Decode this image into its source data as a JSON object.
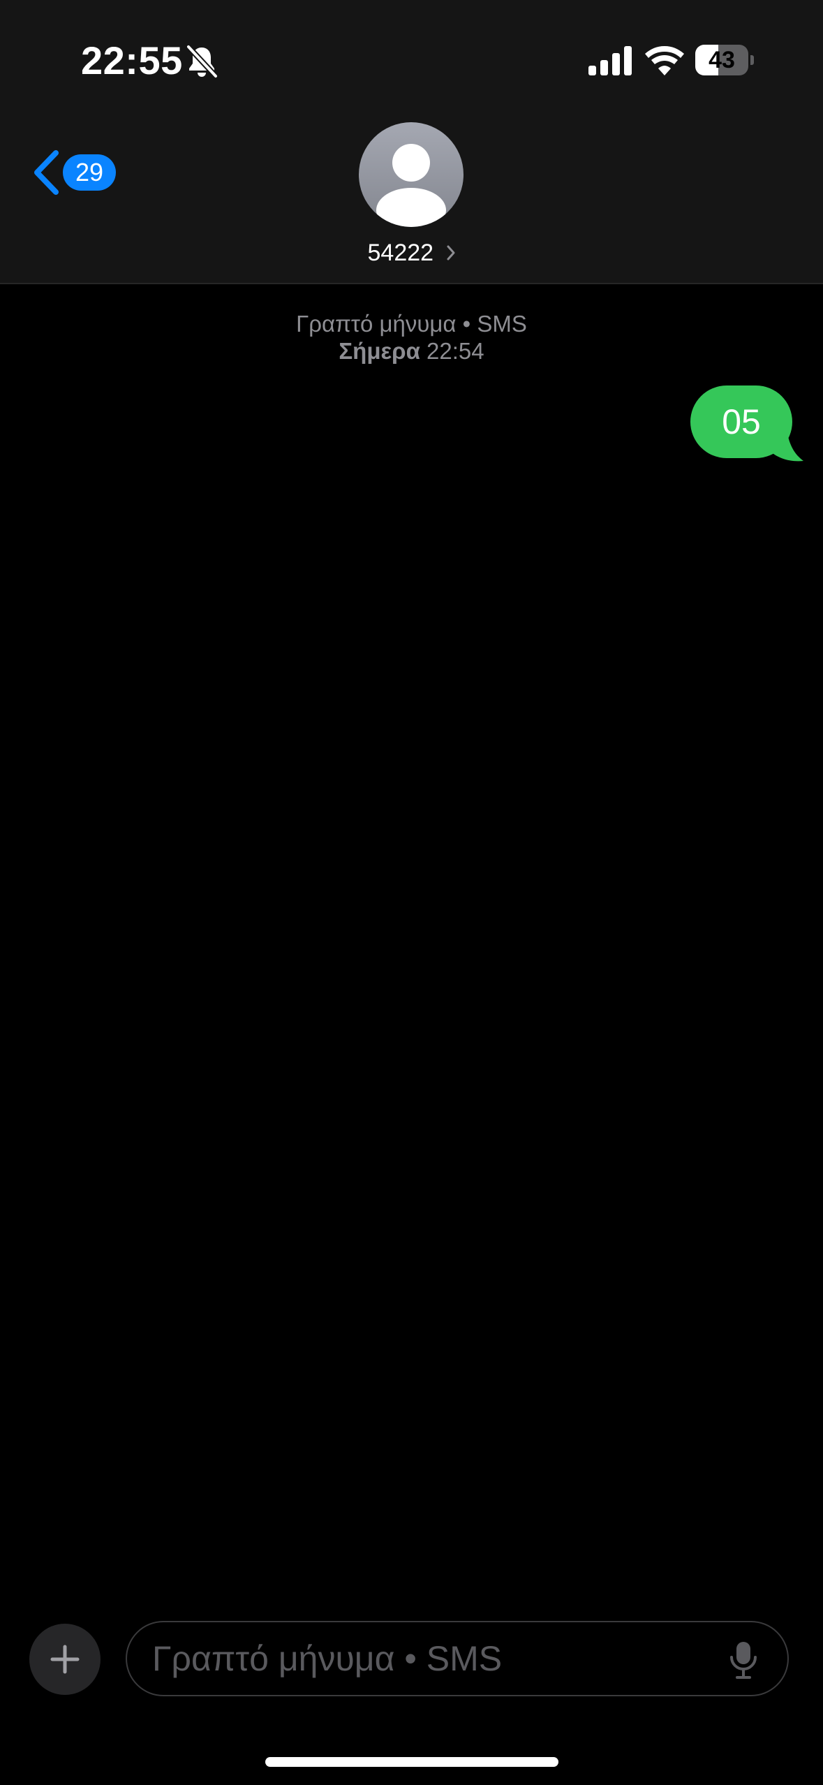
{
  "status_bar": {
    "time": "22:55",
    "battery_level": "43",
    "battery_fraction": 0.43,
    "icons": [
      "bell-slash-icon",
      "cellular-signal-icon",
      "wifi-icon",
      "battery-icon"
    ]
  },
  "nav": {
    "back_badge": "29",
    "contact_name": "54222",
    "icons": [
      "chevron-left-icon",
      "person-icon",
      "chevron-right-icon"
    ]
  },
  "conversation": {
    "service_label": "Γραπτό μήνυμα • SMS",
    "day_label": "Σήμερα",
    "time_label": "22:54",
    "messages": [
      {
        "text": "05",
        "direction": "sent"
      }
    ]
  },
  "composer": {
    "placeholder": "Γραπτό μήνυμα • SMS",
    "value": "",
    "icons": [
      "plus-icon",
      "microphone-icon"
    ]
  },
  "colors": {
    "accent_blue": "#0a84ff",
    "sms_bubble_green": "#35c759",
    "header_bg": "#151515",
    "secondary_text": "#8e8e93"
  }
}
